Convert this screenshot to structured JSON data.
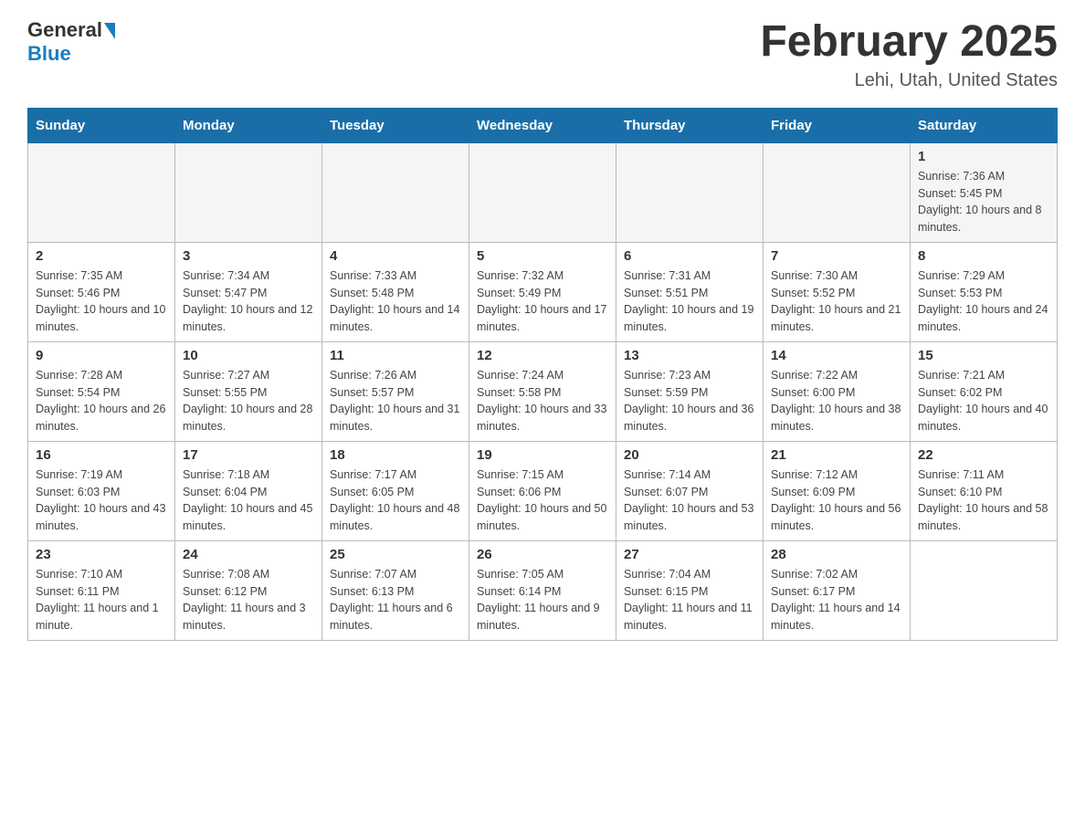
{
  "header": {
    "logo_general": "General",
    "logo_blue": "Blue",
    "main_title": "February 2025",
    "subtitle": "Lehi, Utah, United States"
  },
  "days_of_week": [
    "Sunday",
    "Monday",
    "Tuesday",
    "Wednesday",
    "Thursday",
    "Friday",
    "Saturday"
  ],
  "weeks": [
    {
      "cells": [
        {
          "day": null,
          "info": null
        },
        {
          "day": null,
          "info": null
        },
        {
          "day": null,
          "info": null
        },
        {
          "day": null,
          "info": null
        },
        {
          "day": null,
          "info": null
        },
        {
          "day": null,
          "info": null
        },
        {
          "day": "1",
          "info": "Sunrise: 7:36 AM\nSunset: 5:45 PM\nDaylight: 10 hours and 8 minutes."
        }
      ]
    },
    {
      "cells": [
        {
          "day": "2",
          "info": "Sunrise: 7:35 AM\nSunset: 5:46 PM\nDaylight: 10 hours and 10 minutes."
        },
        {
          "day": "3",
          "info": "Sunrise: 7:34 AM\nSunset: 5:47 PM\nDaylight: 10 hours and 12 minutes."
        },
        {
          "day": "4",
          "info": "Sunrise: 7:33 AM\nSunset: 5:48 PM\nDaylight: 10 hours and 14 minutes."
        },
        {
          "day": "5",
          "info": "Sunrise: 7:32 AM\nSunset: 5:49 PM\nDaylight: 10 hours and 17 minutes."
        },
        {
          "day": "6",
          "info": "Sunrise: 7:31 AM\nSunset: 5:51 PM\nDaylight: 10 hours and 19 minutes."
        },
        {
          "day": "7",
          "info": "Sunrise: 7:30 AM\nSunset: 5:52 PM\nDaylight: 10 hours and 21 minutes."
        },
        {
          "day": "8",
          "info": "Sunrise: 7:29 AM\nSunset: 5:53 PM\nDaylight: 10 hours and 24 minutes."
        }
      ]
    },
    {
      "cells": [
        {
          "day": "9",
          "info": "Sunrise: 7:28 AM\nSunset: 5:54 PM\nDaylight: 10 hours and 26 minutes."
        },
        {
          "day": "10",
          "info": "Sunrise: 7:27 AM\nSunset: 5:55 PM\nDaylight: 10 hours and 28 minutes."
        },
        {
          "day": "11",
          "info": "Sunrise: 7:26 AM\nSunset: 5:57 PM\nDaylight: 10 hours and 31 minutes."
        },
        {
          "day": "12",
          "info": "Sunrise: 7:24 AM\nSunset: 5:58 PM\nDaylight: 10 hours and 33 minutes."
        },
        {
          "day": "13",
          "info": "Sunrise: 7:23 AM\nSunset: 5:59 PM\nDaylight: 10 hours and 36 minutes."
        },
        {
          "day": "14",
          "info": "Sunrise: 7:22 AM\nSunset: 6:00 PM\nDaylight: 10 hours and 38 minutes."
        },
        {
          "day": "15",
          "info": "Sunrise: 7:21 AM\nSunset: 6:02 PM\nDaylight: 10 hours and 40 minutes."
        }
      ]
    },
    {
      "cells": [
        {
          "day": "16",
          "info": "Sunrise: 7:19 AM\nSunset: 6:03 PM\nDaylight: 10 hours and 43 minutes."
        },
        {
          "day": "17",
          "info": "Sunrise: 7:18 AM\nSunset: 6:04 PM\nDaylight: 10 hours and 45 minutes."
        },
        {
          "day": "18",
          "info": "Sunrise: 7:17 AM\nSunset: 6:05 PM\nDaylight: 10 hours and 48 minutes."
        },
        {
          "day": "19",
          "info": "Sunrise: 7:15 AM\nSunset: 6:06 PM\nDaylight: 10 hours and 50 minutes."
        },
        {
          "day": "20",
          "info": "Sunrise: 7:14 AM\nSunset: 6:07 PM\nDaylight: 10 hours and 53 minutes."
        },
        {
          "day": "21",
          "info": "Sunrise: 7:12 AM\nSunset: 6:09 PM\nDaylight: 10 hours and 56 minutes."
        },
        {
          "day": "22",
          "info": "Sunrise: 7:11 AM\nSunset: 6:10 PM\nDaylight: 10 hours and 58 minutes."
        }
      ]
    },
    {
      "cells": [
        {
          "day": "23",
          "info": "Sunrise: 7:10 AM\nSunset: 6:11 PM\nDaylight: 11 hours and 1 minute."
        },
        {
          "day": "24",
          "info": "Sunrise: 7:08 AM\nSunset: 6:12 PM\nDaylight: 11 hours and 3 minutes."
        },
        {
          "day": "25",
          "info": "Sunrise: 7:07 AM\nSunset: 6:13 PM\nDaylight: 11 hours and 6 minutes."
        },
        {
          "day": "26",
          "info": "Sunrise: 7:05 AM\nSunset: 6:14 PM\nDaylight: 11 hours and 9 minutes."
        },
        {
          "day": "27",
          "info": "Sunrise: 7:04 AM\nSunset: 6:15 PM\nDaylight: 11 hours and 11 minutes."
        },
        {
          "day": "28",
          "info": "Sunrise: 7:02 AM\nSunset: 6:17 PM\nDaylight: 11 hours and 14 minutes."
        },
        {
          "day": null,
          "info": null
        }
      ]
    }
  ]
}
